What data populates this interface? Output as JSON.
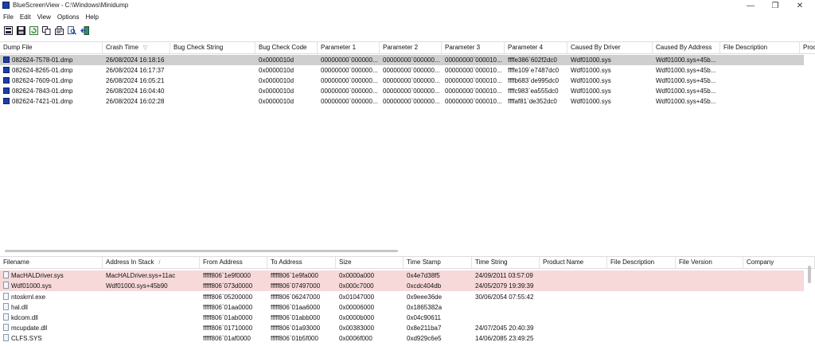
{
  "window": {
    "title": "BlueScreenView - C:\\Windows\\Minidump",
    "minimize": "—",
    "maximize": "❐",
    "close": "✕"
  },
  "menu": [
    "File",
    "Edit",
    "View",
    "Options",
    "Help"
  ],
  "toolbar": [
    "save-icon",
    "floppy-icon",
    "refresh-icon",
    "copy-icon",
    "properties-icon",
    "find-icon",
    "exit-icon"
  ],
  "top_table": {
    "columns": [
      "Dump File",
      "Crash Time",
      "Bug Check String",
      "Bug Check Code",
      "Parameter 1",
      "Parameter 2",
      "Parameter 3",
      "Parameter 4",
      "Caused By Driver",
      "Caused By Address",
      "File Description",
      "Proc"
    ],
    "sort_indicator": "▽",
    "rows": [
      [
        "082624-7578-01.dmp",
        "26/08/2024 16:18:16",
        "",
        "0x0000010d",
        "00000000`000000...",
        "00000000`000000...",
        "00000000`000010...",
        "ffffe386`602f2dc0",
        "Wdf01000.sys",
        "Wdf01000.sys+45b...",
        "",
        ""
      ],
      [
        "082624-8265-01.dmp",
        "26/08/2024 16:17:37",
        "",
        "0x0000010d",
        "00000000`000000...",
        "00000000`000000...",
        "00000000`000010...",
        "ffffe109`e7487dc0",
        "Wdf01000.sys",
        "Wdf01000.sys+45b...",
        "",
        ""
      ],
      [
        "082624-7609-01.dmp",
        "26/08/2024 16:05:21",
        "",
        "0x0000010d",
        "00000000`000000...",
        "00000000`000000...",
        "00000000`000010...",
        "ffffb683`de995dc0",
        "Wdf01000.sys",
        "Wdf01000.sys+45b...",
        "",
        ""
      ],
      [
        "082624-7843-01.dmp",
        "26/08/2024 16:04:40",
        "",
        "0x0000010d",
        "00000000`000000...",
        "00000000`000000...",
        "00000000`000010...",
        "ffffc983`ea555dc0",
        "Wdf01000.sys",
        "Wdf01000.sys+45b...",
        "",
        ""
      ],
      [
        "082624-7421-01.dmp",
        "26/08/2024 16:02:28",
        "",
        "0x0000010d",
        "00000000`000000...",
        "00000000`000000...",
        "00000000`000010...",
        "ffffaf81`de352dc0",
        "Wdf01000.sys",
        "Wdf01000.sys+45b...",
        "",
        ""
      ]
    ]
  },
  "bottom_table": {
    "columns": [
      "Filename",
      "Address In Stack",
      "From Address",
      "To Address",
      "Size",
      "Time Stamp",
      "Time String",
      "Product Name",
      "File Description",
      "File Version",
      "Company"
    ],
    "sort_indicator": "/",
    "rows": [
      [
        "MacHALDriver.sys",
        "MacHALDriver.sys+11ac",
        "fffff806`1e9f0000",
        "fffff806`1e9fa000",
        "0x0000a000",
        "0x4e7d38f5",
        "24/09/2011 03:57:09",
        "",
        "",
        "",
        ""
      ],
      [
        "Wdf01000.sys",
        "Wdf01000.sys+45b90",
        "fffff806`073d0000",
        "fffff806`07497000",
        "0x000c7000",
        "0xcdc404db",
        "24/05/2079 19:39:39",
        "",
        "",
        "",
        ""
      ],
      [
        "ntoskrnl.exe",
        "",
        "fffff806`05200000",
        "fffff806`06247000",
        "0x01047000",
        "0x9eee36de",
        "30/06/2054 07:55:42",
        "",
        "",
        "",
        ""
      ],
      [
        "hal.dll",
        "",
        "fffff806`01aa0000",
        "fffff806`01aa6000",
        "0x00006000",
        "0x1865382a",
        "",
        "",
        "",
        "",
        ""
      ],
      [
        "kdcom.dll",
        "",
        "fffff806`01ab0000",
        "fffff806`01abb000",
        "0x0000b000",
        "0x04c90611",
        "",
        "",
        "",
        "",
        ""
      ],
      [
        "mcupdate.dll",
        "",
        "fffff806`01710000",
        "fffff806`01a93000",
        "0x00383000",
        "0x8e211ba7",
        "24/07/2045 20:40:39",
        "",
        "",
        "",
        ""
      ],
      [
        "CLFS.SYS",
        "",
        "fffff806`01af0000",
        "fffff806`01b5f000",
        "0x0006f000",
        "0xd929c6e5",
        "14/06/2085 23:49:25",
        "",
        "",
        "",
        ""
      ]
    ]
  }
}
